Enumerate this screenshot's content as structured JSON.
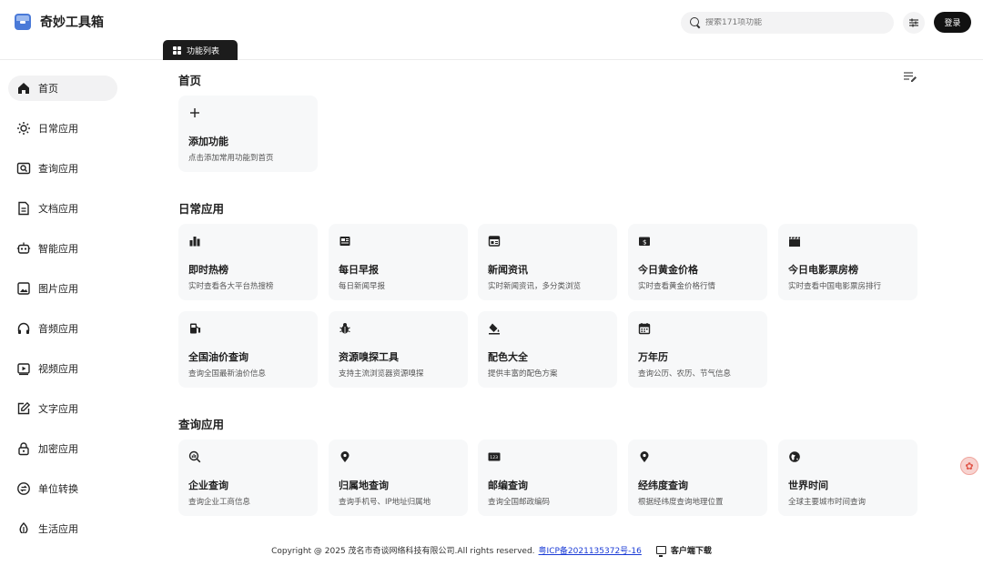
{
  "app": {
    "title": "奇妙工具箱"
  },
  "search": {
    "placeholder": "搜索171项功能"
  },
  "header": {
    "login_label": "登录",
    "func_tab_label": "功能列表"
  },
  "sidebar": {
    "items": [
      {
        "label": "首页",
        "icon": "home-icon"
      },
      {
        "label": "日常应用",
        "icon": "sun-icon"
      },
      {
        "label": "查询应用",
        "icon": "search-box-icon"
      },
      {
        "label": "文档应用",
        "icon": "document-icon"
      },
      {
        "label": "智能应用",
        "icon": "robot-icon"
      },
      {
        "label": "图片应用",
        "icon": "image-icon"
      },
      {
        "label": "音频应用",
        "icon": "headphones-icon"
      },
      {
        "label": "视频应用",
        "icon": "video-icon"
      },
      {
        "label": "文字应用",
        "icon": "edit-text-icon"
      },
      {
        "label": "加密应用",
        "icon": "lock-icon"
      },
      {
        "label": "单位转换",
        "icon": "convert-icon"
      },
      {
        "label": "生活应用",
        "icon": "leaf-icon"
      }
    ]
  },
  "home": {
    "title": "首页",
    "add_card": {
      "title": "添加功能",
      "desc": "点击添加常用功能到首页",
      "icon": "plus-icon"
    }
  },
  "daily": {
    "title": "日常应用",
    "cards": [
      {
        "title": "即时热榜",
        "desc": "实时查看各大平台热搜榜",
        "icon": "bar-chart-icon"
      },
      {
        "title": "每日早报",
        "desc": "每日新闻早报",
        "icon": "newspaper-icon"
      },
      {
        "title": "新闻资讯",
        "desc": "实时新闻资讯，多分类浏览",
        "icon": "news-icon"
      },
      {
        "title": "今日黄金价格",
        "desc": "实时查看黄金价格行情",
        "icon": "money-icon"
      },
      {
        "title": "今日电影票房榜",
        "desc": "实时查看中国电影票房排行",
        "icon": "clapperboard-icon"
      },
      {
        "title": "全国油价查询",
        "desc": "查询全国最新油价信息",
        "icon": "fuel-icon"
      },
      {
        "title": "资源嗅探工具",
        "desc": "支持主流浏览器资源嗅探",
        "icon": "bug-icon"
      },
      {
        "title": "配色大全",
        "desc": "提供丰富的配色方案",
        "icon": "paint-bucket-icon"
      },
      {
        "title": "万年历",
        "desc": "查询公历、农历、节气信息",
        "icon": "calendar-icon"
      }
    ]
  },
  "query": {
    "title": "查询应用",
    "cards": [
      {
        "title": "企业查询",
        "desc": "查询企业工商信息",
        "icon": "magnifier-chart-icon"
      },
      {
        "title": "归属地查询",
        "desc": "查询手机号、IP地址归属地",
        "icon": "location-pin-icon"
      },
      {
        "title": "邮编查询",
        "desc": "查询全国邮政编码",
        "icon": "number-123-icon",
        "icon_text": "123"
      },
      {
        "title": "经纬度查询",
        "desc": "根据经纬度查询地理位置",
        "icon": "location-pin-icon"
      },
      {
        "title": "世界时间",
        "desc": "全球主要城市时间查询",
        "icon": "globe-icon"
      }
    ]
  },
  "footer": {
    "copyright": "Copyright @ 2025 茂名市奇谈网络科技有限公司.All rights reserved.",
    "icp": "粤ICP备2021135372号-16",
    "client_download": "客户端下载"
  },
  "colors": {
    "accent": "#111111",
    "card_bg": "#f7f8f9",
    "active_bg": "#f2f2f3",
    "link": "#1a3bd6",
    "logo": "#4a7ad8"
  }
}
